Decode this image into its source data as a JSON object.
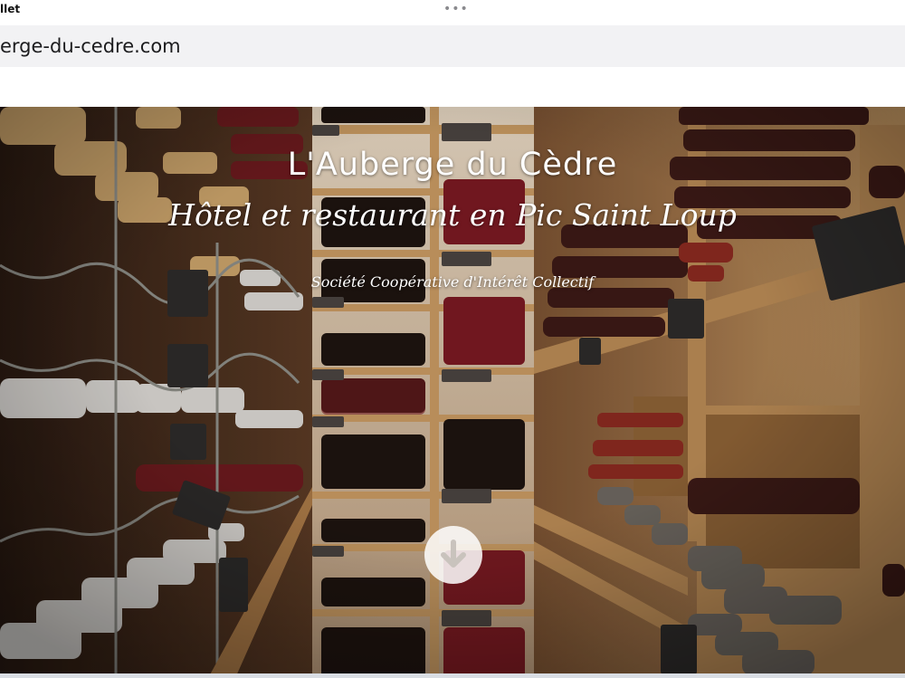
{
  "status": {
    "left_text": "llet"
  },
  "browser": {
    "url": "erge-du-cedre.com"
  },
  "hero": {
    "title": "L'Auberge du Cèdre",
    "subtitle": "Hôtel et restaurant en Pic Saint Loup",
    "tagline": "Société Coopérative d'Intérêt Collectif"
  },
  "scroll_button": {
    "icon": "arrow-down-icon"
  },
  "colors": {
    "wood": "#b98a55",
    "dark_wine": "#3a1a12",
    "label_white": "#ffffff"
  }
}
